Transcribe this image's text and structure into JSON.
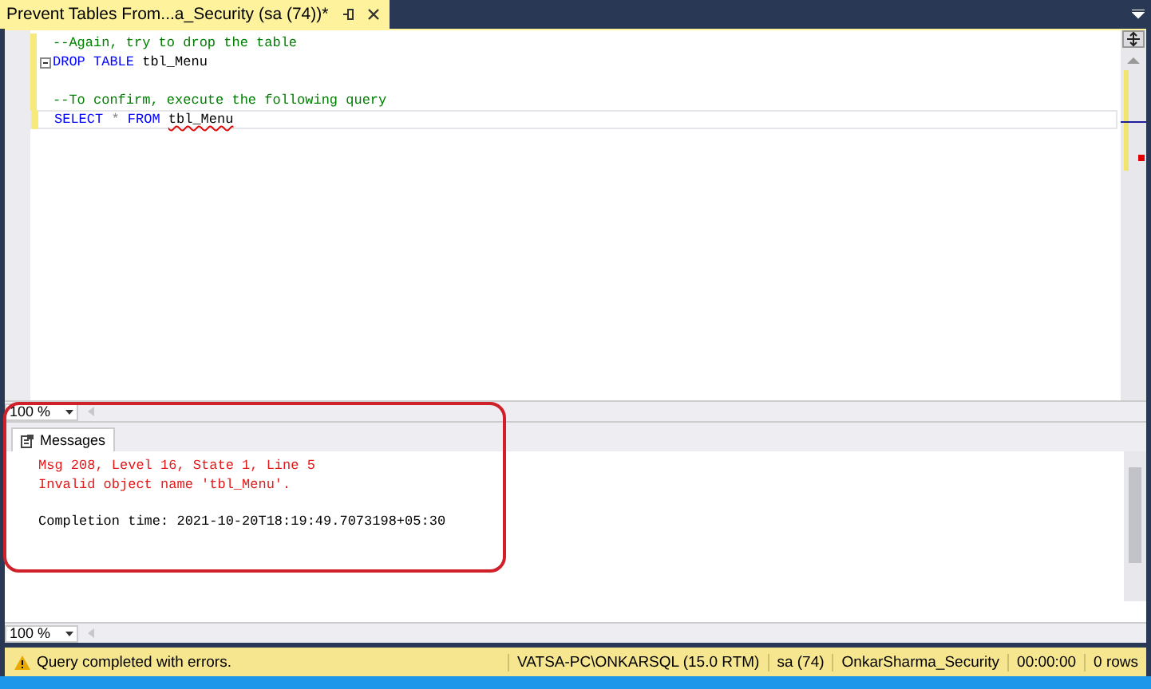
{
  "document_tab": {
    "title": "Prevent Tables From...a_Security (sa (74))*",
    "selected": true
  },
  "editor": {
    "lines": [
      {
        "changed": true,
        "current": false,
        "foldable": false,
        "tokens": [
          {
            "kind": "comment",
            "text": "--Again, try to drop the table"
          }
        ]
      },
      {
        "changed": true,
        "current": false,
        "foldable": true,
        "tokens": [
          {
            "kind": "keyword",
            "text": "DROP TABLE"
          },
          {
            "kind": "plain",
            "text": "tbl_Menu"
          }
        ]
      },
      {
        "changed": true,
        "current": false,
        "foldable": false
      },
      {
        "changed": true,
        "current": false,
        "foldable": false,
        "tokens": [
          {
            "kind": "comment",
            "text": "--To confirm, execute the following query"
          }
        ]
      },
      {
        "changed": true,
        "current": true,
        "foldable": false,
        "tokens": [
          {
            "kind": "keyword",
            "text": "SELECT"
          },
          {
            "kind": "operator",
            "text": "*"
          },
          {
            "kind": "keyword",
            "text": "FROM"
          },
          {
            "kind": "error",
            "text": "tbl_Menu"
          }
        ]
      }
    ]
  },
  "editor_zoom": "100 %",
  "results_tabs": [
    {
      "label": "Messages",
      "selected": true
    }
  ],
  "messages": [
    {
      "kind": "error",
      "text": "Msg 208, Level 16, State 1, Line 5"
    },
    {
      "kind": "error",
      "text": "Invalid object name 'tbl_Menu'."
    },
    {
      "kind": "blank"
    },
    {
      "kind": "info",
      "text": "Completion time: 2021-10-20T18:19:49.7073198+05:30"
    }
  ],
  "results_zoom": "100 %",
  "status_bar": {
    "message": "Query completed with errors.",
    "fields": [
      "VATSA-PC\\ONKARSQL (15.0 RTM)",
      "sa (74)",
      "OnkarSharma_Security",
      "00:00:00",
      "0 rows"
    ]
  }
}
